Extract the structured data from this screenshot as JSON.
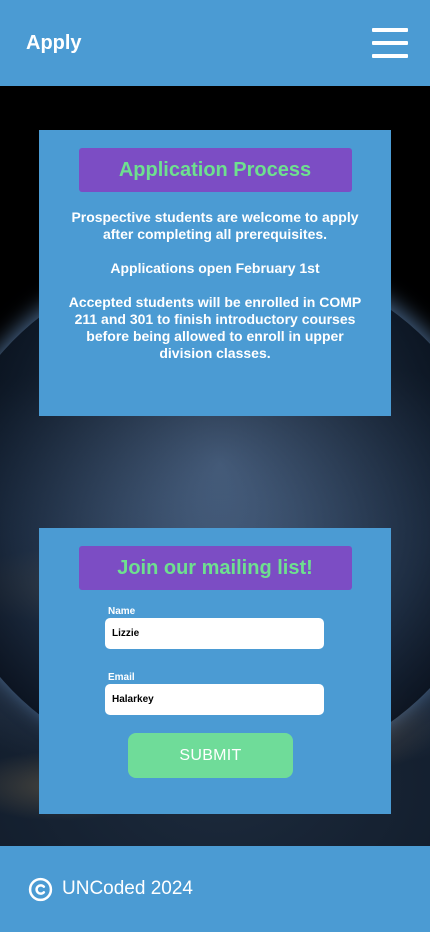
{
  "header": {
    "title": "Apply",
    "menu_icon": "hamburger-menu-icon"
  },
  "application": {
    "title": "Application Process",
    "paragraphs": [
      "Prospective students are welcome to apply after completing all prerequisites.",
      "Applications open February 1st",
      "Accepted students will be enrolled in COMP 211 and 301 to finish introductory courses before being allowed to enroll in upper division classes."
    ]
  },
  "mailing": {
    "title": "Join our mailing list!",
    "name_label": "Name",
    "name_value": "Lizzie",
    "email_label": "Email",
    "email_value": "Halarkey",
    "submit_label": "SUBMIT"
  },
  "footer": {
    "text": "UNCoded 2024",
    "icon": "copyright-icon"
  },
  "colors": {
    "bar": "#4b9bd3",
    "title_bg": "#7c4dc4",
    "title_text": "#6ee08f",
    "submit": "#6fdc99"
  }
}
